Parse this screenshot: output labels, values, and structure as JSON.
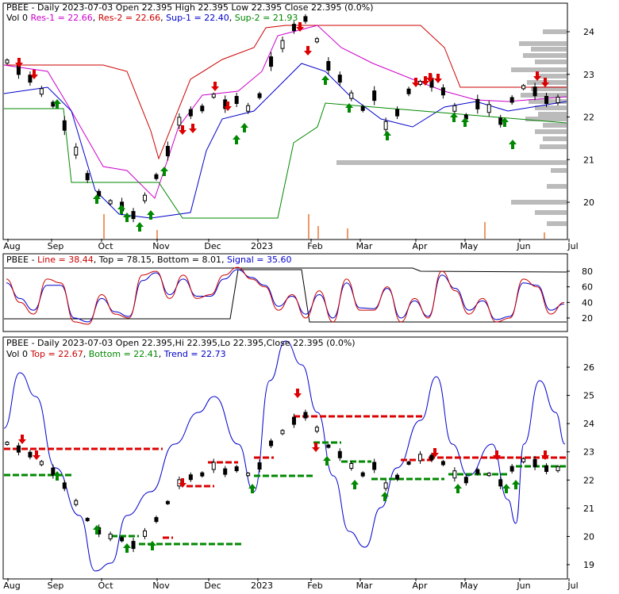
{
  "chart_data": [
    {
      "type": "candlestick",
      "title": "PBEE - Daily 2023-07-03 Open 22.395  High 22.395  Low 22.395  Close 22.395 (0.0%)",
      "legend": [
        {
          "label": "Vol 0",
          "color": "#000000"
        },
        {
          "label": "Res-1 = 22.66",
          "color": "#cc00cc"
        },
        {
          "label": "Res-2 = 22.66",
          "color": "#cc0000"
        },
        {
          "label": "Sup-1 = 22.40",
          "color": "#0000cc"
        },
        {
          "label": "Sup-2 = 21.93",
          "color": "#008800"
        }
      ],
      "x_tick_labels": [
        "Aug",
        "Sep",
        "Oct",
        "Nov",
        "Dec",
        "2023",
        "Feb",
        "Mar",
        "Apr",
        "May",
        "Jun",
        "Jul"
      ],
      "y_tick_labels": [
        "20",
        "21",
        "22",
        "23",
        "24"
      ],
      "ylim": [
        19.4,
        24.6
      ],
      "close_series": [
        23.3,
        23.1,
        22.9,
        22.6,
        22.3,
        21.8,
        21.2,
        20.6,
        20.2,
        20.0,
        19.9,
        19.7,
        20.1,
        20.6,
        21.2,
        21.9,
        22.1,
        22.2,
        22.5,
        22.3,
        22.4,
        22.2,
        22.5,
        23.3,
        23.7,
        24.1,
        24.3,
        23.8,
        23.2,
        22.9,
        22.5,
        22.2,
        22.5,
        21.8,
        22.1,
        22.6,
        22.8,
        22.8,
        22.6,
        22.2,
        22.0,
        22.3,
        22.2,
        21.9,
        22.4,
        22.7,
        22.6,
        22.4,
        22.4
      ]
    },
    {
      "type": "line",
      "legend": [
        {
          "label": "PBEE",
          "color": "#000000"
        },
        {
          "label": "Line = 38.44",
          "color": "#cc0000"
        },
        {
          "label": "Top = 78.15",
          "color": "#000000"
        },
        {
          "label": "Bottom = 8.01",
          "color": "#000000"
        },
        {
          "label": "Signal = 35.60",
          "color": "#0000cc"
        }
      ],
      "y_tick_labels": [
        "20",
        "40",
        "60",
        "80"
      ],
      "ylim": [
        5,
        95
      ],
      "line_series": [
        70,
        40,
        25,
        70,
        65,
        15,
        12,
        50,
        25,
        20,
        75,
        80,
        45,
        75,
        45,
        50,
        75,
        85,
        70,
        60,
        30,
        50,
        20,
        55,
        15,
        70,
        30,
        30,
        60,
        15,
        45,
        20,
        80,
        55,
        25,
        45,
        15,
        20,
        70,
        60,
        25,
        40
      ],
      "signal_series": [
        65,
        45,
        30,
        62,
        62,
        20,
        15,
        45,
        28,
        22,
        68,
        78,
        50,
        70,
        48,
        48,
        70,
        82,
        72,
        62,
        35,
        48,
        25,
        50,
        20,
        65,
        33,
        32,
        58,
        20,
        42,
        22,
        75,
        58,
        30,
        42,
        18,
        22,
        65,
        62,
        30,
        38
      ]
    },
    {
      "type": "candlestick",
      "title": "PBEE - Daily 2023-07-03 Open 22.395,Hi 22.395,Lo 22.395,Close 22.395 (0.0%)",
      "legend": [
        {
          "label": "Vol 0",
          "color": "#000000"
        },
        {
          "label": "Top = 22.67",
          "color": "#cc0000"
        },
        {
          "label": "Bottom = 22.41",
          "color": "#008800"
        },
        {
          "label": "Trend = 22.73",
          "color": "#0000cc"
        }
      ],
      "x_tick_labels": [
        "Aug",
        "Sep",
        "Oct",
        "Nov",
        "Dec",
        "2023",
        "Feb",
        "Mar",
        "Apr",
        "May",
        "Jun",
        "Jul"
      ],
      "y_tick_labels": [
        "19",
        "20",
        "21",
        "22",
        "23",
        "24",
        "25",
        "26"
      ],
      "ylim": [
        18.7,
        26.8
      ]
    }
  ]
}
